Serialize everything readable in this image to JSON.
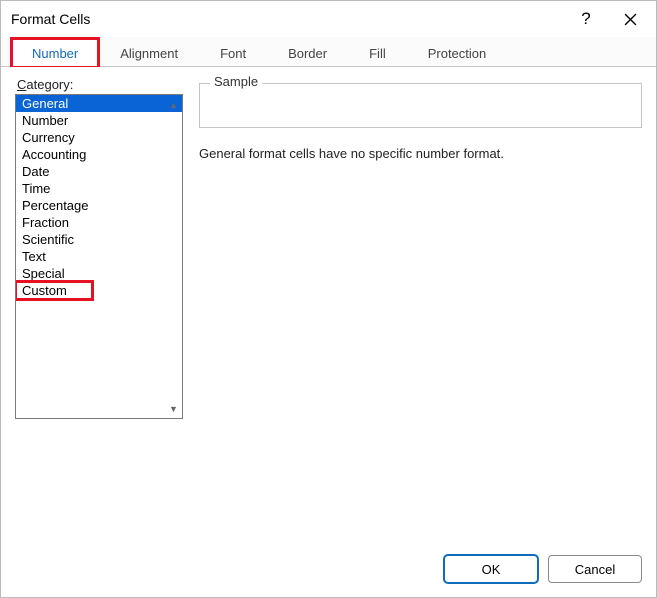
{
  "titlebar": {
    "title": "Format Cells",
    "help": "?",
    "close": "✕"
  },
  "tabs": [
    {
      "label": "Number",
      "active": true,
      "highlight": true
    },
    {
      "label": "Alignment",
      "active": false,
      "highlight": false
    },
    {
      "label": "Font",
      "active": false,
      "highlight": false
    },
    {
      "label": "Border",
      "active": false,
      "highlight": false
    },
    {
      "label": "Fill",
      "active": false,
      "highlight": false
    },
    {
      "label": "Protection",
      "active": false,
      "highlight": false
    }
  ],
  "category": {
    "label_prefix": "C",
    "label_rest": "ategory:",
    "items": [
      {
        "label": "General",
        "selected": true,
        "highlight": false
      },
      {
        "label": "Number",
        "selected": false,
        "highlight": false
      },
      {
        "label": "Currency",
        "selected": false,
        "highlight": false
      },
      {
        "label": "Accounting",
        "selected": false,
        "highlight": false
      },
      {
        "label": "Date",
        "selected": false,
        "highlight": false
      },
      {
        "label": "Time",
        "selected": false,
        "highlight": false
      },
      {
        "label": "Percentage",
        "selected": false,
        "highlight": false
      },
      {
        "label": "Fraction",
        "selected": false,
        "highlight": false
      },
      {
        "label": "Scientific",
        "selected": false,
        "highlight": false
      },
      {
        "label": "Text",
        "selected": false,
        "highlight": false
      },
      {
        "label": "Special",
        "selected": false,
        "highlight": false
      },
      {
        "label": "Custom",
        "selected": false,
        "highlight": true
      }
    ]
  },
  "panel": {
    "sample_label": "Sample",
    "description": "General format cells have no specific number format."
  },
  "footer": {
    "ok": "OK",
    "cancel": "Cancel"
  }
}
